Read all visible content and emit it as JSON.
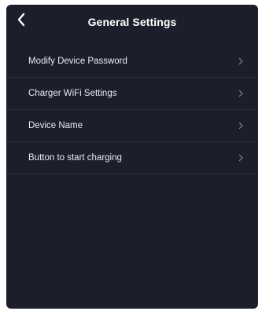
{
  "header": {
    "title": "General Settings",
    "back_icon": "chevron-left-icon"
  },
  "settings": {
    "items": [
      {
        "label": "Modify Device Password",
        "icon": "chevron-right-icon"
      },
      {
        "label": "Charger WiFi Settings",
        "icon": "chevron-right-icon"
      },
      {
        "label": "Device Name",
        "icon": "chevron-right-icon"
      },
      {
        "label": "Button to start charging",
        "icon": "chevron-right-icon"
      }
    ]
  },
  "colors": {
    "background": "#1c1f2b",
    "divider": "#2b2f3c",
    "text": "#ffffff",
    "chevron": "#7d8190"
  }
}
